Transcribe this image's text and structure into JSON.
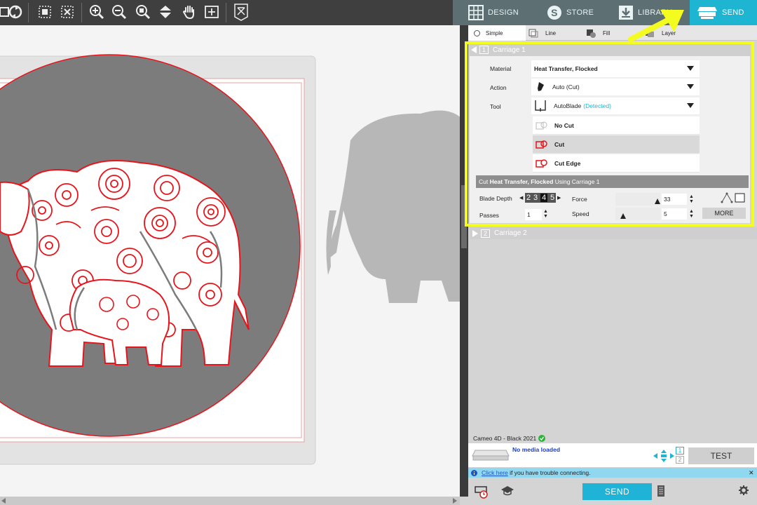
{
  "toolbar": {
    "icons": [
      "group-icon",
      "replicate-icon",
      "select-all-icon",
      "deselect-icon",
      "zoom-in-icon",
      "zoom-out-icon",
      "zoom-fit-icon",
      "move-down-icon",
      "pan-hand-icon",
      "fit-page-icon",
      "trace-icon"
    ]
  },
  "nav": {
    "tabs": [
      {
        "label": "DESIGN",
        "icon": "grid-icon"
      },
      {
        "label": "STORE",
        "icon": "store-s-icon"
      },
      {
        "label": "LIBRARY",
        "icon": "library-download-icon"
      },
      {
        "label": "SEND",
        "icon": "cutter-icon",
        "active": true
      }
    ]
  },
  "modes": [
    {
      "label": "Simple",
      "active": true
    },
    {
      "label": "Line"
    },
    {
      "label": "Fill"
    },
    {
      "label": "Layer"
    }
  ],
  "carriage1": {
    "number": "1",
    "title": "Carriage 1",
    "material_label": "Material",
    "material_value": "Heat Transfer, Flocked",
    "action_label": "Action",
    "action_value": "Auto (Cut)",
    "tool_label": "Tool",
    "tool_value": "AutoBlade",
    "tool_status": "(Detected)",
    "options": [
      {
        "label": "No Cut"
      },
      {
        "label": "Cut",
        "selected": true
      },
      {
        "label": "Cut Edge"
      }
    ],
    "summary_prefix": "Cut",
    "summary_material": "Heat Transfer, Flocked",
    "summary_suffix": "Using Carriage 1",
    "blade_depth_label": "Blade Depth",
    "blade_depth_digits": [
      "2",
      "3",
      "4",
      "5"
    ],
    "blade_depth_value": 4,
    "passes_label": "Passes",
    "passes_value": "1",
    "force_label": "Force",
    "force_value": "33",
    "speed_label": "Speed",
    "speed_value": "5",
    "more_label": "MORE"
  },
  "carriage2": {
    "number": "2",
    "title": "Carriage 2"
  },
  "device": {
    "name": "Cameo 4D - Black 2021",
    "media_status": "No media loaded",
    "pages": [
      "1",
      "2"
    ],
    "test_label": "TEST"
  },
  "info": {
    "link": "Click here",
    "text": " if you have trouble connecting."
  },
  "send_label": "SEND",
  "colors": {
    "accent": "#1db5d1",
    "highlight": "#f4fb1f",
    "cut_line": "#e8141b",
    "toolbar": "#3f3f3f"
  }
}
